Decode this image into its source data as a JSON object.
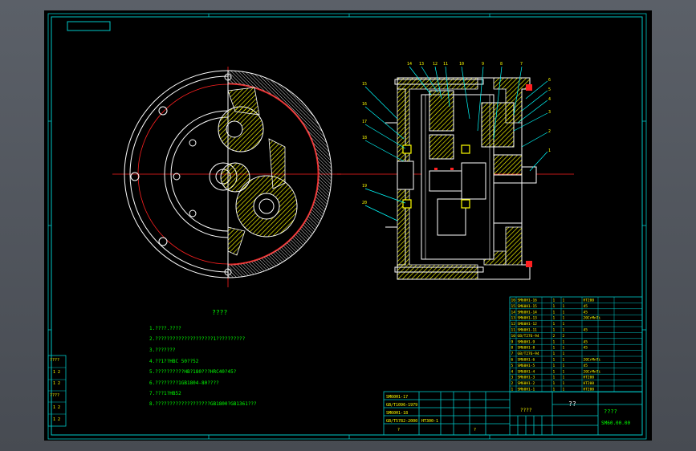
{
  "colors": {
    "background": "#000000",
    "frame": "#00c8c8",
    "outline": "#ffffff",
    "hatch": "#ffff00",
    "center_line": "#ff2020",
    "note_text": "#00ff00",
    "leader": "#00ffff",
    "viewport": "#4a4e55"
  },
  "notes": {
    "title": "????",
    "lines": [
      "1.????.????",
      "2.????????????????????1??????????",
      "3.???????",
      "4.??1??HBC 50??52",
      "5.??????????HB?180???HRC40?45?",
      "6.????????1GB1804-80????",
      "7.???1?HB52",
      "8.???????????????????GB1800?GB1361???"
    ]
  },
  "parts_list": {
    "rows": [
      [
        "16",
        "SM60H1-16",
        "1",
        "1",
        "HT200"
      ],
      [
        "15",
        "SM60H1-15",
        "1",
        "1",
        "45"
      ],
      [
        "14",
        "SM60H1-14",
        "1",
        "1",
        "45"
      ],
      [
        "13",
        "SM60H1-13",
        "1",
        "1",
        "20CrMnTi"
      ],
      [
        "12",
        "SM60H1-12",
        "1",
        "1",
        ""
      ],
      [
        "11",
        "SM60H1-11",
        "1",
        "1",
        "45"
      ],
      [
        "10",
        "GB/T276-94",
        "2",
        "2",
        ""
      ],
      [
        "9",
        "SM60H1-9",
        "1",
        "1",
        "45"
      ],
      [
        "8",
        "SM60H1-8",
        "1",
        "1",
        "45"
      ],
      [
        "7",
        "GB/T276-94",
        "1",
        "1",
        ""
      ],
      [
        "6",
        "SM60H1-6",
        "1",
        "1",
        "20CrMnTi"
      ],
      [
        "5",
        "SM60H1-5",
        "1",
        "1",
        "45"
      ],
      [
        "4",
        "SM60H1-4",
        "1",
        "1",
        "20CrMnTi"
      ],
      [
        "3",
        "SM60H1-3",
        "1",
        "1",
        "HT200"
      ],
      [
        "2",
        "SM60H1-2",
        "1",
        "1",
        "HT200"
      ],
      [
        "1",
        "SM60H1-1",
        "1",
        "1",
        "HT200"
      ]
    ]
  },
  "title_block": {
    "company": "????",
    "title": "??",
    "part_name": "????",
    "drawing_no": "SM60.00.00",
    "left_rows": [
      [
        "SM60H1-17",
        ""
      ],
      [
        "GB/T1096-1979",
        ""
      ],
      [
        "SM60H1-18",
        ""
      ],
      [
        "GB/T5782-2000",
        "HT300-1"
      ],
      [
        "?",
        "?"
      ]
    ]
  },
  "left_strip": [
    "????",
    "1 2",
    "1 2",
    "????",
    "1 2",
    "1 2"
  ],
  "callouts": {
    "top": [
      "14",
      "13",
      "12",
      "11",
      "10",
      "9",
      "8",
      "7"
    ],
    "right": [
      "6",
      "5",
      "4",
      "3",
      "2",
      "1"
    ],
    "left": [
      "15",
      "16",
      "17",
      "18",
      "19",
      "20"
    ]
  }
}
